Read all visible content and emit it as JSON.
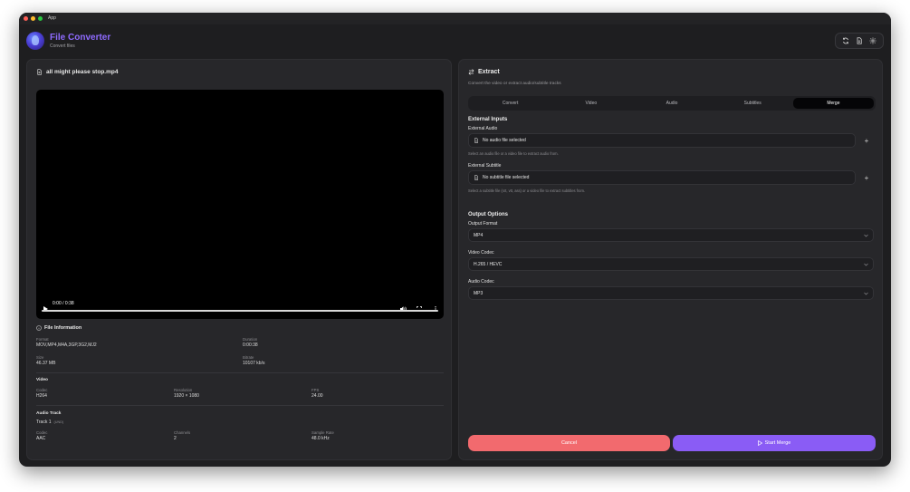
{
  "window": {
    "title": "App"
  },
  "app": {
    "name": "File Converter",
    "subtitle": "Convert files"
  },
  "header_icons": [
    "refresh-icon",
    "document-icon",
    "gear-icon"
  ],
  "left": {
    "filename": "all might please stop.mp4",
    "player": {
      "time": "0:00 / 0:38",
      "progress": 0.0
    },
    "file_info": {
      "title": "File Information",
      "format_label": "Format",
      "format_value": "MOV,MP4,M4A,3GP,3G2,MJ2",
      "duration_label": "Duration",
      "duration_value": "0:00:38",
      "size_label": "Size",
      "size_value": "46.37 MB",
      "bitrate_label": "Bitrate",
      "bitrate_value": "10107 kb/s"
    },
    "video": {
      "title": "Video",
      "codec_label": "Codec",
      "codec_value": "H264",
      "resolution_label": "Resolution",
      "resolution_value": "1920 × 1080",
      "fps_label": "FPS",
      "fps_value": "24.00"
    },
    "audio": {
      "title": "Audio Track",
      "track_name": "Track 1",
      "track_badge": "(UND)",
      "codec_label": "Codec",
      "codec_value": "AAC",
      "channels_label": "Channels",
      "channels_value": "2",
      "sample_rate_label": "Sample Rate",
      "sample_rate_value": "48.0 kHz"
    }
  },
  "right": {
    "title": "Extract",
    "description": "Convert the video or extract audio/subtitle tracks",
    "tabs": [
      {
        "label": "Convert",
        "active": false
      },
      {
        "label": "Video",
        "active": false
      },
      {
        "label": "Audio",
        "active": false
      },
      {
        "label": "Subtitles",
        "active": false
      },
      {
        "label": "Merge",
        "active": true
      }
    ],
    "external_inputs": {
      "title": "External Inputs",
      "audio_label": "External Audio",
      "audio_value": "No audio file selected",
      "audio_help": "Select an audio file or a video file to extract audio from.",
      "subtitle_label": "External Subtitle",
      "subtitle_value": "No subtitle file selected",
      "subtitle_help": "Select a subtitle file (srt, vtt, ass) or a video file to extract subtitles from."
    },
    "output_options": {
      "title": "Output Options",
      "format_label": "Output Format",
      "format_value": "MP4",
      "video_codec_label": "Video Codec",
      "video_codec_value": "H.265 / HEVC",
      "audio_codec_label": "Audio Codec",
      "audio_codec_value": "MP3"
    },
    "cancel_label": "Cancel",
    "start_label": "Start Merge"
  },
  "colors": {
    "accent": "#8a5cf5",
    "cancel": "#f26a6e",
    "app_name": "#8f6bff"
  }
}
